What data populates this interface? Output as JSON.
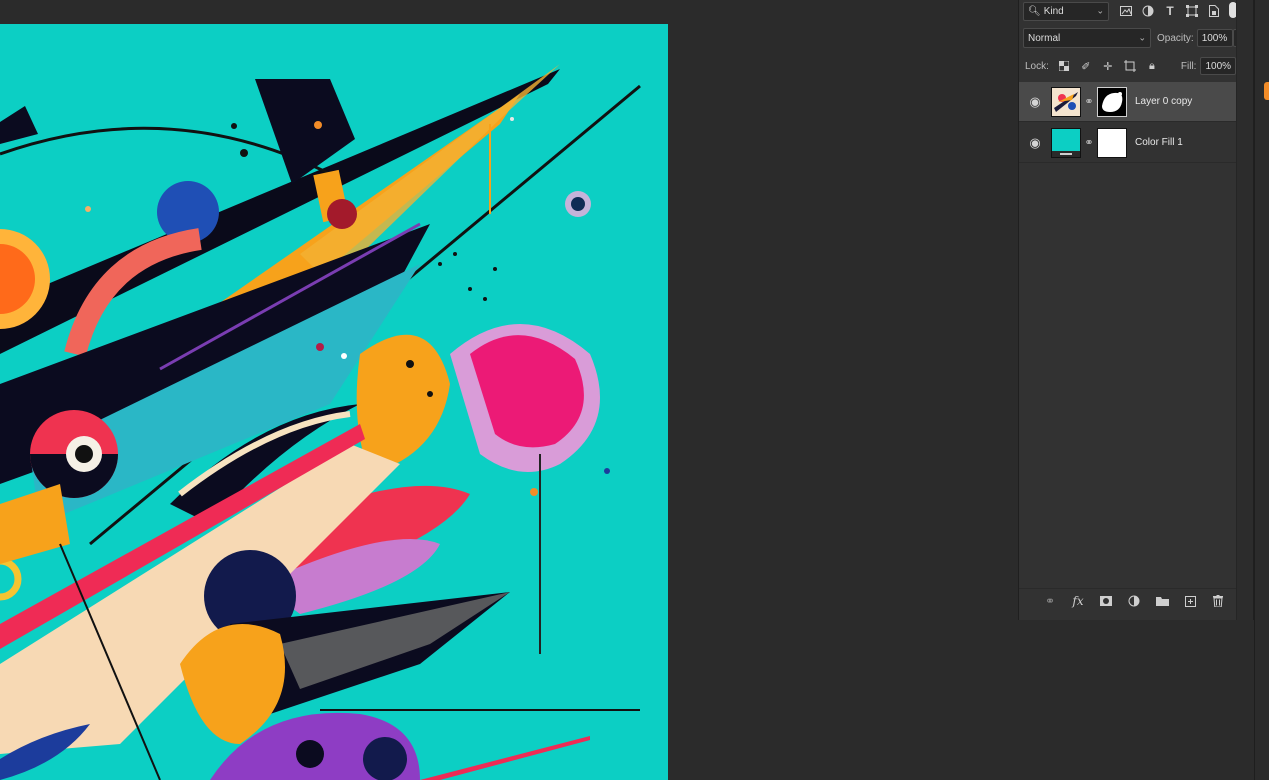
{
  "layers_panel": {
    "filter": {
      "label": "Kind",
      "icons": [
        "image-filter-icon",
        "adjustment-filter-icon",
        "type-filter-icon",
        "shape-filter-icon",
        "smart-object-filter-icon"
      ]
    },
    "blend_mode": "Normal",
    "opacity_label": "Opacity:",
    "opacity_value": "100%",
    "lock_label": "Lock:",
    "fill_label": "Fill:",
    "fill_value": "100%",
    "layers": [
      {
        "name": "Layer 0 copy",
        "visible": true,
        "selected": true
      },
      {
        "name": "Color Fill 1",
        "visible": true,
        "selected": false
      }
    ]
  },
  "colors": {
    "canvas_background": "#0ccfc4",
    "workspace": "#2b2b2b",
    "panel": "#323232",
    "selected_row": "#4a4a4a",
    "accent": "#f28c28"
  }
}
